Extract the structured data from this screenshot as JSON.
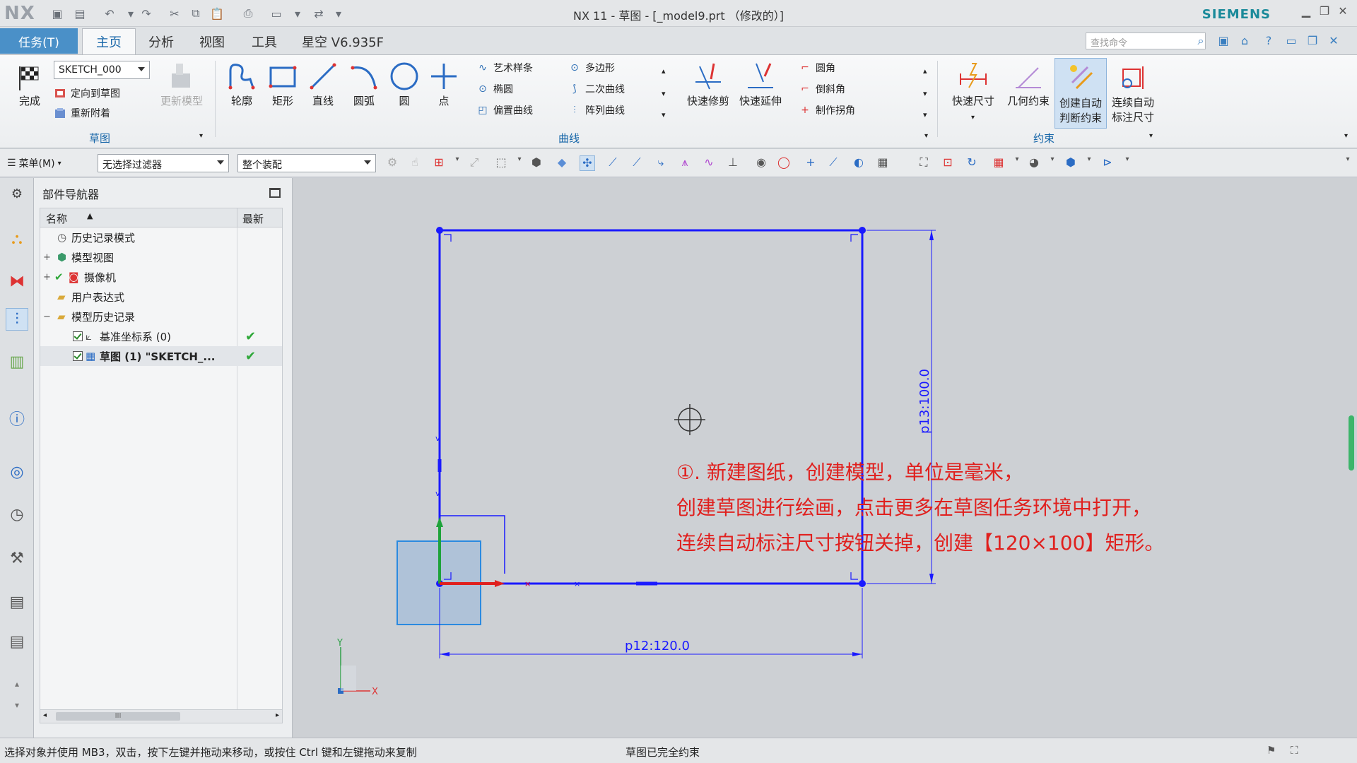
{
  "window": {
    "logo": "NX",
    "title": "NX 11 - 草图 - [_model9.prt （修改的）]",
    "brand": "SIEMENS"
  },
  "ribbon_tabs": {
    "task": "任务(T)",
    "tabs": [
      "主页",
      "分析",
      "视图",
      "工具",
      "星空 V6.935F"
    ],
    "search_placeholder": "查找命令"
  },
  "sketch_group": {
    "finish": "完成",
    "sketch_name": "SKETCH_000",
    "orient": "定向到草图",
    "reattach": "重新附着",
    "update_model": "更新模型",
    "label": "草图"
  },
  "curve_group": {
    "big": [
      "轮廓",
      "矩形",
      "直线",
      "圆弧",
      "圆",
      "点"
    ],
    "small_col1": [
      "艺术样条",
      "椭圆",
      "偏置曲线"
    ],
    "small_col2": [
      "多边形",
      "二次曲线",
      "阵列曲线"
    ],
    "trim": "快速修剪",
    "extend": "快速延伸",
    "small_col3": [
      "圆角",
      "倒斜角",
      "制作拐角"
    ],
    "label": "曲线"
  },
  "constraint_group": {
    "rapid_dim": "快速尺寸",
    "geo_constraint": "几何约束",
    "auto_constraint": [
      "创建自动",
      "判断约束"
    ],
    "auto_dim": [
      "连续自动",
      "标注尺寸"
    ],
    "label": "约束"
  },
  "toolbar2": {
    "menu": "菜单(M)",
    "filter": "无选择过滤器",
    "assembly": "整个装配"
  },
  "navigator": {
    "title": "部件导航器",
    "col_name": "名称",
    "col_latest": "最新",
    "items": [
      {
        "label": "历史记录模式"
      },
      {
        "label": "模型视图"
      },
      {
        "label": "摄像机"
      },
      {
        "label": "用户表达式"
      },
      {
        "label": "模型历史记录"
      },
      {
        "label": "基准坐标系 (0)"
      },
      {
        "label": "草图 (1) \"SKETCH_..."
      }
    ]
  },
  "drawing": {
    "dim_horizontal": "p12:120.0",
    "dim_vertical": "p13:100.0",
    "axis_x": "X",
    "axis_y": "Y"
  },
  "annotation": {
    "line1": "①. 新建图纸，创建模型，单位是毫米，",
    "line2": "创建草图进行绘画，点击更多在草图任务环境中打开，",
    "line3": "连续自动标注尺寸按钮关掉，创建【120×100】矩形。"
  },
  "status": {
    "left": "选择对象并使用 MB3，双击，按下左键并拖动来移动，或按住 Ctrl 键和左键拖动来复制",
    "center": "草图已完全约束"
  },
  "colors": {
    "sketch_curve": "#1a1aff",
    "annotation": "#e0201e",
    "accent": "#4a90c8"
  }
}
